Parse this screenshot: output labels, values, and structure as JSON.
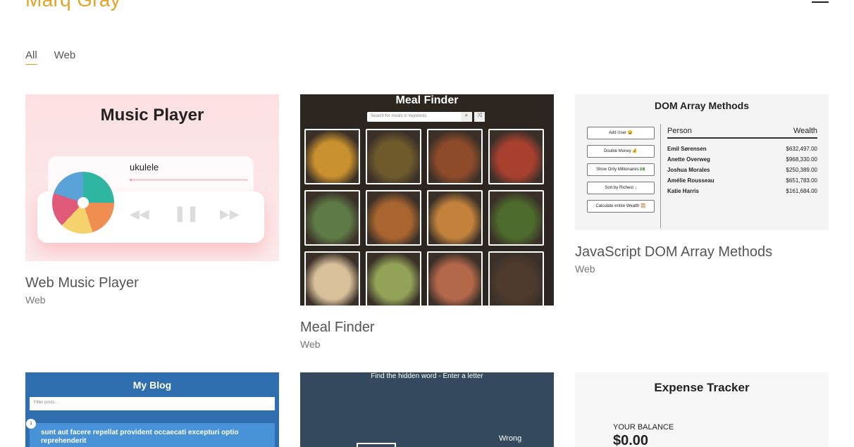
{
  "site": {
    "title": "Marq Gray"
  },
  "filters": [
    {
      "label": "All"
    },
    {
      "label": "Web"
    }
  ],
  "projects": [
    {
      "title": "Web Music Player",
      "category": "Web",
      "thumb": {
        "heading": "Music Player",
        "song": "ukulele",
        "progress": 0.02
      }
    },
    {
      "title": "Meal Finder",
      "category": "Web",
      "thumb": {
        "heading": "Meal Finder",
        "search_placeholder": "Search for meals or keywords",
        "meal_colors": [
          "#c8902e",
          "#6f5a2c",
          "#8e4b2a",
          "#a8402f",
          "#5e7a46",
          "#a9652f",
          "#c2823c",
          "#4d6b2c",
          "#d8c09a",
          "#92a257",
          "#b4684a",
          "#4e3b2e"
        ]
      }
    },
    {
      "title": "JavaScript DOM Array Methods",
      "category": "Web",
      "thumb": {
        "heading": "DOM Array Methods",
        "buttons": [
          "Add User 😀",
          "Double Money 💰",
          "Show Only Millionaires 💵",
          "Sort by Richest ↓",
          "Calculate entire Wealth 🧮"
        ],
        "col_person": "Person",
        "col_wealth": "Wealth",
        "rows": [
          {
            "name": "Emil Sørensen",
            "wealth": "$632,497.00"
          },
          {
            "name": "Anette Overweg",
            "wealth": "$968,330.00"
          },
          {
            "name": "Joshua Morales",
            "wealth": "$250,389.00"
          },
          {
            "name": "Amélie Rousseau",
            "wealth": "$651,783.00"
          },
          {
            "name": "Katie Harris",
            "wealth": "$161,684.00"
          }
        ]
      }
    },
    {
      "thumb": {
        "heading": "My Blog",
        "filter_placeholder": "Filter posts...",
        "post_number": "1",
        "post_title": "sunt aut facere repellat provident occaecati excepturi optio reprehenderit"
      }
    },
    {
      "thumb": {
        "message": "Find the hidden word - Enter a letter",
        "wrong_label": "Wrong"
      }
    },
    {
      "thumb": {
        "heading": "Expense Tracker",
        "balance_label": "YOUR BALANCE",
        "balance": "$0.00"
      }
    }
  ]
}
